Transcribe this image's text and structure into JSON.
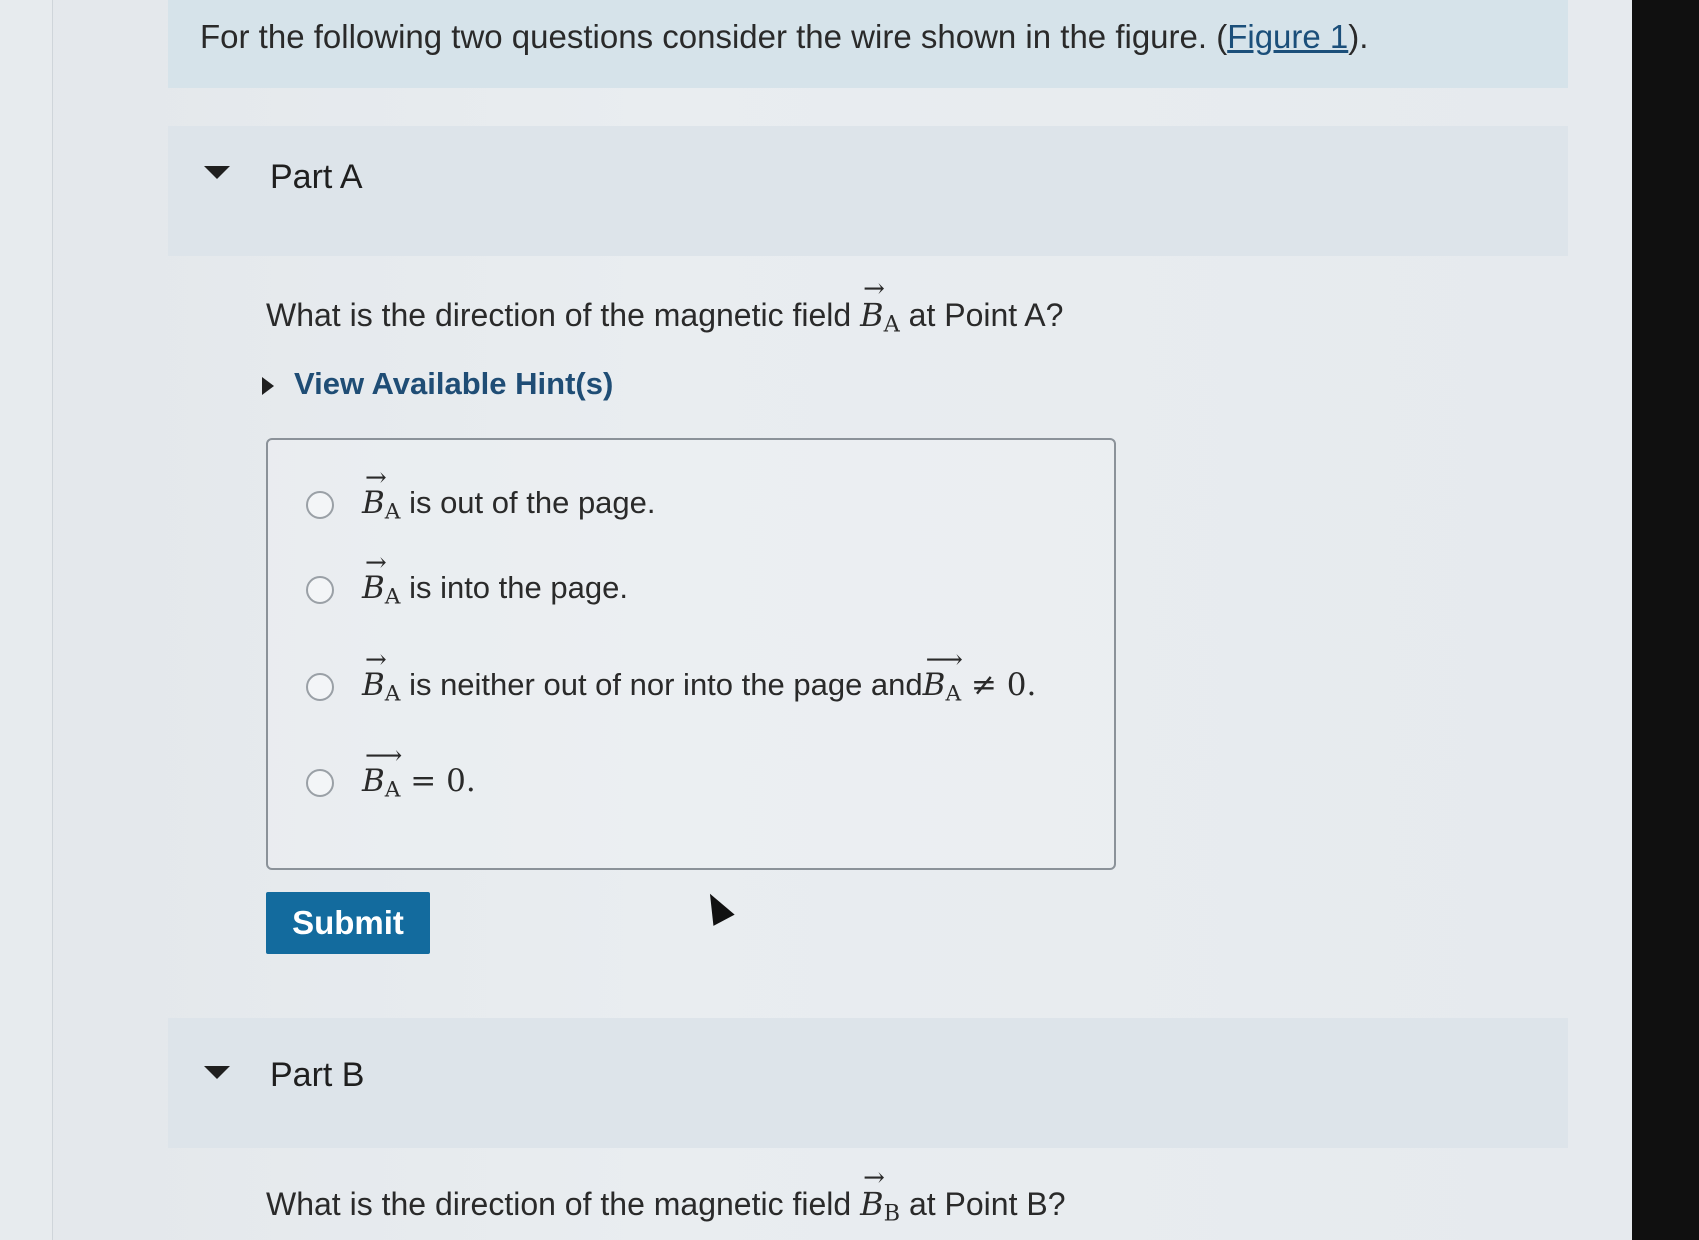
{
  "intro": {
    "text": "For the following two questions consider the wire shown in the figure. (",
    "figure_link": "Figure 1",
    "suffix": ")."
  },
  "part_a": {
    "title": "Part A",
    "question_prefix": "What is the direction of the magnetic field ",
    "question_vector": "B",
    "question_subscript": "A",
    "question_suffix": " at Point A?",
    "hint_label": "View Available Hint(s)",
    "choices": [
      {
        "vector": "B",
        "subscript": "A",
        "text": " is out of the page."
      },
      {
        "vector": "B",
        "subscript": "A",
        "text": " is into the page."
      },
      {
        "vector": "B",
        "subscript": "A",
        "text": " is neither out of nor into the page and",
        "tail_vector": "B",
        "tail_subscript": "A",
        "tail_math": " ≠ 0."
      },
      {
        "vector": "B",
        "subscript": "A",
        "math": " = 0."
      }
    ],
    "submit_label": "Submit"
  },
  "part_b": {
    "title": "Part B",
    "question_prefix": "What is the direction of the magnetic field ",
    "question_vector": "B",
    "question_subscript": "B",
    "question_suffix": " at Point B?"
  },
  "icons": {
    "collapse": "caret-down-icon",
    "expand": "caret-right-icon",
    "radio": "radio-circle-icon",
    "pointer": "mouse-pointer-icon"
  },
  "colors": {
    "submit_bg": "#136b9e",
    "link": "#1b4f7a",
    "banner_bg": "#d6e3ea"
  }
}
